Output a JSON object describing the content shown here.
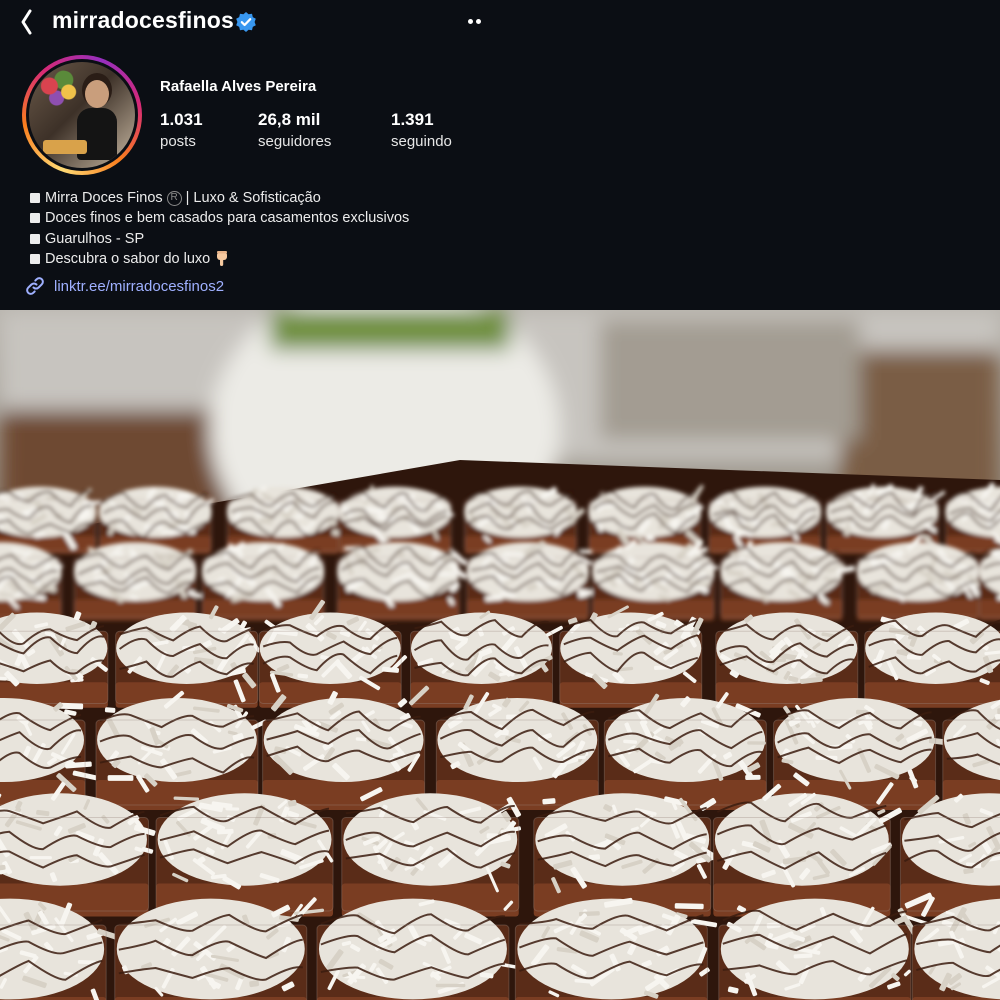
{
  "header": {
    "username": "mirradocesfinos",
    "verified": true,
    "back_icon": "chevron-left-icon",
    "more_icon": "more-dots-icon"
  },
  "profile": {
    "full_name": "Rafaella Alves Pereira",
    "stats": {
      "posts": {
        "value": "1.031",
        "label": "posts"
      },
      "followers": {
        "value": "26,8 mil",
        "label": "seguidores"
      },
      "following": {
        "value": "1.391",
        "label": "seguindo"
      }
    },
    "bio": {
      "line1_a": "Mirra Doces Finos",
      "line1_b": "| Luxo & Sofisticação",
      "line2": "Doces finos e bem casados para casamentos exclusivos",
      "line3": "Guarulhos - SP",
      "line4": "Descubra o sabor do luxo"
    },
    "link": "linktr.ee/mirradocesfinos2"
  },
  "colors": {
    "background": "#0b0e14",
    "link": "#9fb0ff",
    "verified": "#3897f0",
    "chocolate": "#4a2416",
    "coconut": "#f3f1ec"
  },
  "photo": {
    "subject": "coconut-chocolate-dessert-cups"
  }
}
